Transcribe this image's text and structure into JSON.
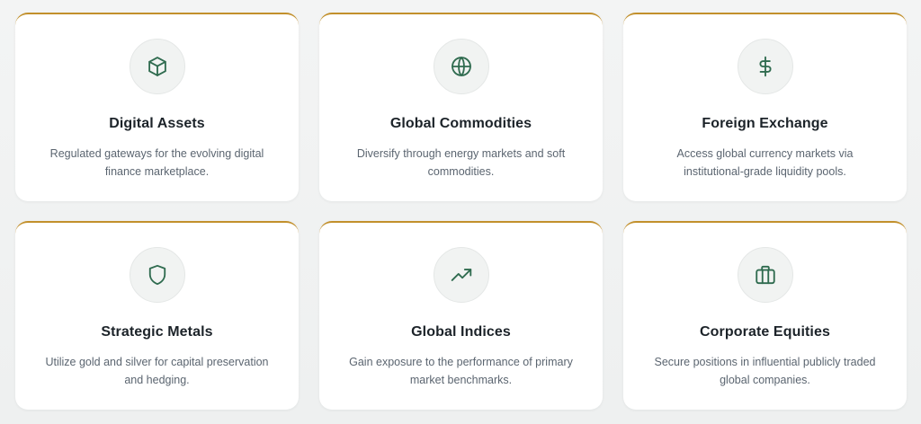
{
  "cards": [
    {
      "icon": "cube-icon",
      "title": "Digital Assets",
      "desc": "Regulated gateways for the evolving digital finance marketplace."
    },
    {
      "icon": "globe-icon",
      "title": "Global Commodities",
      "desc": "Diversify through energy markets and soft commodities."
    },
    {
      "icon": "dollar-icon",
      "title": "Foreign Exchange",
      "desc": "Access global currency markets via institutional-grade liquidity pools."
    },
    {
      "icon": "shield-icon",
      "title": "Strategic Metals",
      "desc": "Utilize gold and silver for capital preservation and hedging."
    },
    {
      "icon": "trending-up-icon",
      "title": "Global Indices",
      "desc": "Gain exposure to the performance of primary market benchmarks."
    },
    {
      "icon": "briefcase-icon",
      "title": "Corporate Equities",
      "desc": "Secure positions in influential publicly traded global companies."
    }
  ],
  "colors": {
    "accent_border": "#c2902c",
    "icon_stroke": "#2f6b4f",
    "title": "#1c2329",
    "description": "#5b6570"
  }
}
